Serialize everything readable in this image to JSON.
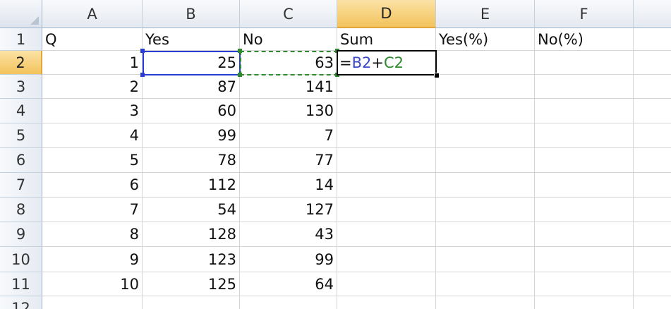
{
  "columns": [
    "A",
    "B",
    "C",
    "D",
    "E",
    "F"
  ],
  "active_column": "D",
  "rows": [
    "1",
    "2",
    "3",
    "4",
    "5",
    "6",
    "7",
    "8",
    "9",
    "10",
    "11",
    "12"
  ],
  "active_row": "2",
  "header_row": [
    "Q",
    "Yes",
    "No",
    "Sum",
    "Yes(%)",
    "No(%)"
  ],
  "data_rows": [
    {
      "q": "1",
      "yes": "25",
      "no": "63"
    },
    {
      "q": "2",
      "yes": "87",
      "no": "141"
    },
    {
      "q": "3",
      "yes": "60",
      "no": "130"
    },
    {
      "q": "4",
      "yes": "99",
      "no": "7"
    },
    {
      "q": "5",
      "yes": "78",
      "no": "77"
    },
    {
      "q": "6",
      "yes": "112",
      "no": "14"
    },
    {
      "q": "7",
      "yes": "54",
      "no": "127"
    },
    {
      "q": "8",
      "yes": "128",
      "no": "43"
    },
    {
      "q": "9",
      "yes": "123",
      "no": "99"
    },
    {
      "q": "10",
      "yes": "125",
      "no": "64"
    }
  ],
  "editing_cell": {
    "address": "D2",
    "formula_parts": [
      {
        "text": "=",
        "role": "op"
      },
      {
        "text": "B2",
        "role": "ref-b"
      },
      {
        "text": "+",
        "role": "op"
      },
      {
        "text": "C2",
        "role": "ref-c"
      }
    ]
  },
  "colors": {
    "ref_b": "#3a48c8",
    "ref_c": "#2e8b2e",
    "header_active": "#f3c35c",
    "gridline": "#d4d4d4"
  }
}
